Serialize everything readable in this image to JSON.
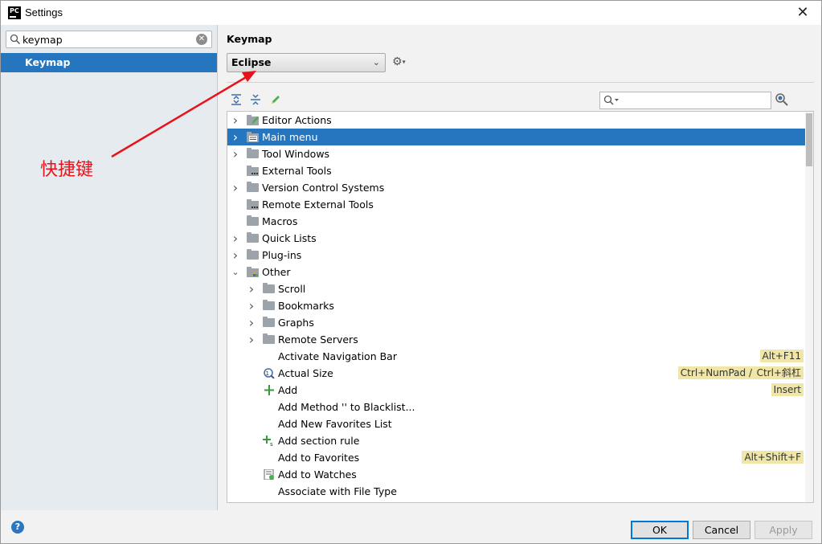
{
  "window": {
    "title": "Settings",
    "app_icon_text": "PC"
  },
  "sidebar": {
    "search": {
      "value": "keymap"
    },
    "items": [
      {
        "label": "Keymap",
        "selected": true
      }
    ]
  },
  "annotation": {
    "text": "快捷键",
    "color": "#e8131a"
  },
  "keymap": {
    "title": "Keymap",
    "scheme": "Eclipse",
    "filter": {
      "value": ""
    }
  },
  "tree": [
    {
      "label": "Editor Actions",
      "expander": ">",
      "icon": "editor-actions-icon"
    },
    {
      "label": "Main menu",
      "expander": ">",
      "icon": "main-menu-icon",
      "selected": true
    },
    {
      "label": "Tool Windows",
      "expander": ">",
      "icon": "folder-icon"
    },
    {
      "label": "External Tools",
      "expander": "",
      "icon": "external-tools-icon"
    },
    {
      "label": "Version Control Systems",
      "expander": ">",
      "icon": "folder-icon"
    },
    {
      "label": "Remote External Tools",
      "expander": "",
      "icon": "external-tools-icon"
    },
    {
      "label": "Macros",
      "expander": "",
      "icon": "folder-icon"
    },
    {
      "label": "Quick Lists",
      "expander": ">",
      "icon": "folder-icon"
    },
    {
      "label": "Plug-ins",
      "expander": ">",
      "icon": "folder-icon"
    },
    {
      "label": "Other",
      "expander": "v",
      "icon": "other-folder-icon"
    },
    {
      "label": "Scroll",
      "expander": ">",
      "icon": "folder-icon",
      "level": 1
    },
    {
      "label": "Bookmarks",
      "expander": ">",
      "icon": "folder-icon",
      "level": 1
    },
    {
      "label": "Graphs",
      "expander": ">",
      "icon": "folder-icon",
      "level": 1
    },
    {
      "label": "Remote Servers",
      "expander": ">",
      "icon": "folder-icon",
      "level": 1
    },
    {
      "label": "Activate Navigation Bar",
      "level": 1,
      "shortcuts": [
        "Alt+F11"
      ]
    },
    {
      "label": "Actual Size",
      "level": 1,
      "icon": "actual-size-icon",
      "shortcuts": [
        "Ctrl+NumPad /",
        "Ctrl+斜杠"
      ]
    },
    {
      "label": "Add",
      "level": 1,
      "icon": "add-icon",
      "shortcuts": [
        "Insert"
      ]
    },
    {
      "label": "Add Method '' to Blacklist...",
      "level": 1
    },
    {
      "label": "Add New Favorites List",
      "level": 1
    },
    {
      "label": "Add section rule",
      "level": 1,
      "icon": "add-section-icon"
    },
    {
      "label": "Add to Favorites",
      "level": 1,
      "shortcuts": [
        "Alt+Shift+F"
      ]
    },
    {
      "label": "Add to Watches",
      "level": 1,
      "icon": "watches-icon"
    },
    {
      "label": "Associate with File Type",
      "level": 1
    }
  ],
  "buttons": {
    "help": "?",
    "ok": "OK",
    "cancel": "Cancel",
    "apply": "Apply"
  }
}
